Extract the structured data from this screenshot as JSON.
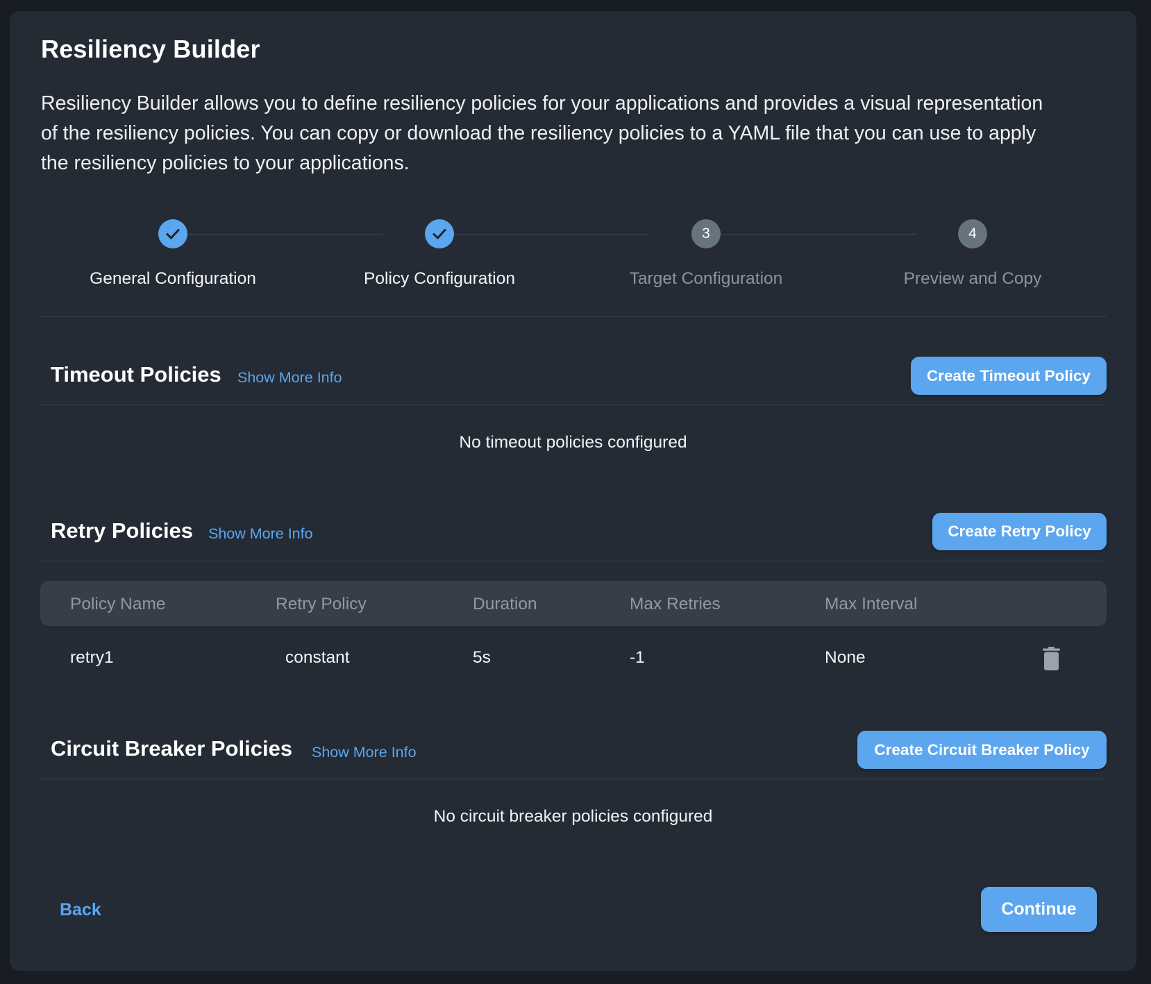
{
  "page": {
    "title": "Resiliency Builder",
    "description_lines": [
      "Resiliency Builder allows you to define resiliency policies for your applications and provides a visual representation",
      "of the resiliency policies. You can copy or download the resiliency policies to a YAML file that you can use to apply",
      "the resiliency policies to your applications."
    ]
  },
  "stepper": {
    "steps": [
      {
        "label": "General Configuration",
        "status": "complete",
        "marker": "check-icon"
      },
      {
        "label": "Policy Configuration",
        "status": "complete",
        "marker": "check-icon"
      },
      {
        "label": "Target Configuration",
        "status": "pending",
        "number": "3"
      },
      {
        "label": "Preview and Copy",
        "status": "pending",
        "number": "4"
      }
    ]
  },
  "sections": {
    "timeout": {
      "title": "Timeout Policies",
      "more_info": "Show More Info",
      "create_label": "Create Timeout Policy",
      "empty_text": "No timeout policies configured"
    },
    "retry": {
      "title": "Retry Policies",
      "more_info": "Show More Info",
      "create_label": "Create Retry Policy",
      "table": {
        "columns": [
          "Policy Name",
          "Retry Policy",
          "Duration",
          "Max Retries",
          "Max Interval"
        ],
        "rows": [
          {
            "policy_name": "retry1",
            "retry_policy": "constant",
            "duration": "5s",
            "max_retries": "-1",
            "max_interval": "None",
            "action_icon": "trash-icon"
          }
        ]
      }
    },
    "circuit_breaker": {
      "title": "Circuit Breaker Policies",
      "more_info": "Show More Info",
      "create_label": "Create Circuit Breaker Policy",
      "empty_text": "No circuit breaker policies configured"
    }
  },
  "footer": {
    "back_label": "Back",
    "continue_label": "Continue"
  },
  "colors": {
    "accent": "#5ba6ee",
    "card_background": "#242b35",
    "page_background": "#181c23",
    "pending_step": "#67737f",
    "table_header_bg": "#363e49"
  }
}
